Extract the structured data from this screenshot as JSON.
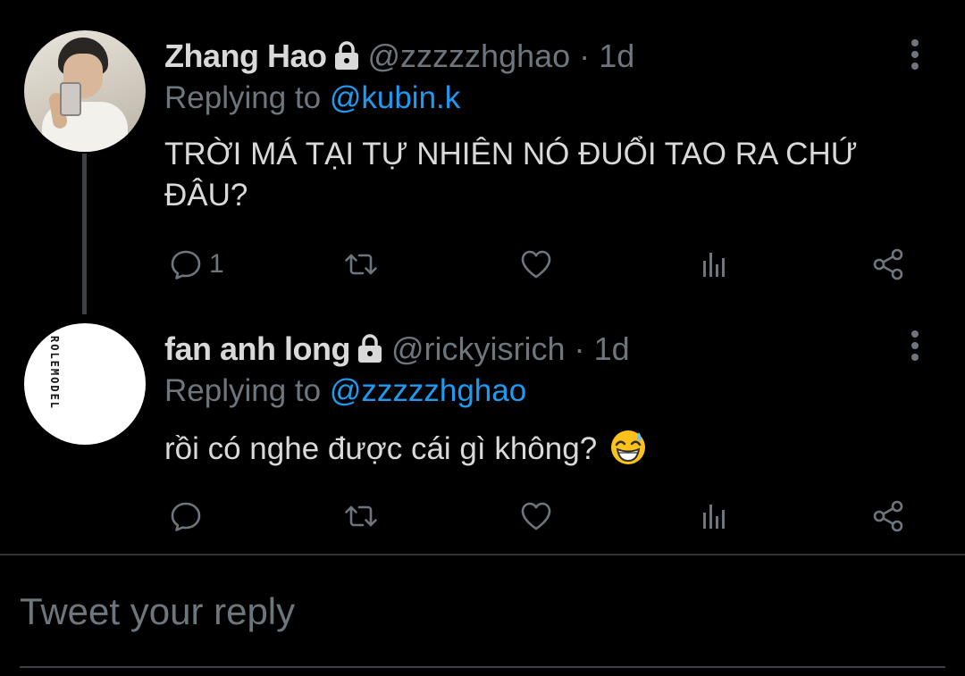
{
  "theme": {
    "background": "#000000",
    "text_color": "#d9d9d9",
    "secondary_text": "#6e767d",
    "accent": "#1d9bf0"
  },
  "tweets": [
    {
      "display_name": "Zhang Hao",
      "handle": "@zzzzzhghao",
      "separator": "·",
      "time": "1d",
      "protected_icon": "lock-icon",
      "replying_prefix": "Replying to",
      "replying_to": "@kubin.k",
      "text": "TRỜI MÁ TẠI TỰ NHIÊN NÓ ĐUỔI TAO RA CHỨ ĐÂU?",
      "reply_count": "1",
      "avatar_icon": "profile-photo-avatar"
    },
    {
      "display_name": "fan anh long",
      "handle": "@rickyisrich",
      "separator": "·",
      "time": "1d",
      "protected_icon": "lock-icon",
      "replying_prefix": "Replying to",
      "replying_to": "@zzzzzhghao",
      "text": "rồi có nghe được cái gì không?",
      "emoji": "grinning-face-with-sweat",
      "reply_count": "",
      "avatar_icon": "logo-avatar",
      "avatar_logo_text": "ROLEMODEL"
    }
  ],
  "action_icons": [
    "reply-icon",
    "retweet-icon",
    "like-icon",
    "analytics-icon",
    "share-icon"
  ],
  "composer": {
    "placeholder": "Tweet your reply",
    "value": ""
  }
}
